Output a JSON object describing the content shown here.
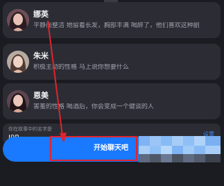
{
  "characters": [
    {
      "name": "娜英",
      "description": "平静而整洁 她留着长发，胸部丰满 喝醉了，他们喜欢这种剧"
    },
    {
      "name": "朱米",
      "description": "积极主动的性格 马上说你想要什么"
    },
    {
      "name": "恩美",
      "description": "害羞的性格 喝酒后，你会变成一个健谈的人"
    }
  ],
  "story_name": {
    "label": "你在故事中的名字是",
    "value": "J9P",
    "settings_label": "设置"
  },
  "start_button": {
    "label": "开始聊天吧"
  },
  "colors": {
    "background": "#1b1c21",
    "card": "#2c2d34",
    "accent": "#1979ff",
    "annotation": "#e0242e"
  }
}
